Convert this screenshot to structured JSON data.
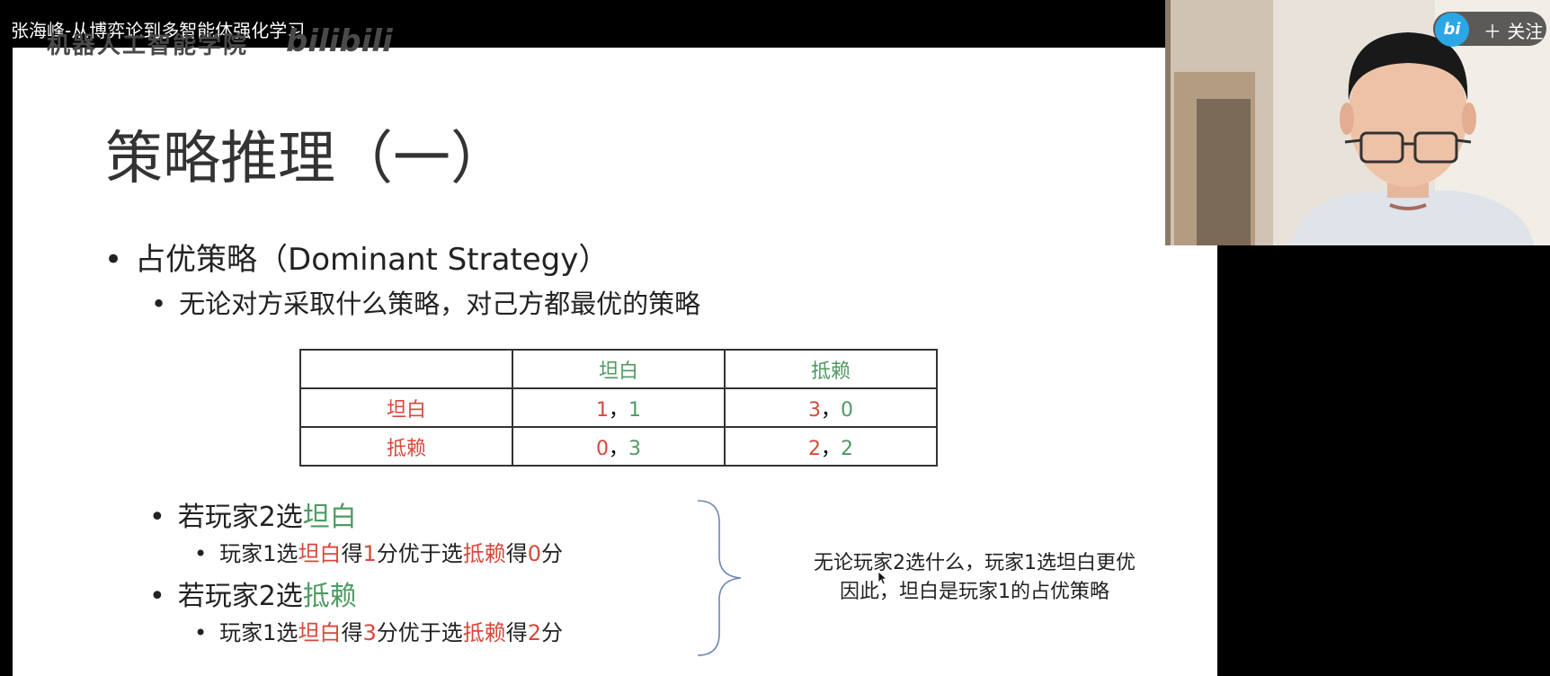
{
  "video": {
    "title": "张海峰-从博弈论到多智能体强化学习"
  },
  "watermark": {
    "text": "机器人工智能学院",
    "logo": "bilibili"
  },
  "player": {
    "follow_button": "＋ 关注",
    "logo_label": "bi"
  },
  "slide": {
    "title": "策略推理（一）",
    "bullet1": "占优策略（Dominant Strategy）",
    "bullet1_sub": "无论对方采取什么策略，对己方都最优的策略",
    "table": {
      "header": [
        "",
        "坦白",
        "抵赖"
      ],
      "rows": [
        {
          "label": "坦白",
          "cells": [
            {
              "a": "1",
              "b": "1"
            },
            {
              "a": "3",
              "b": "0"
            }
          ]
        },
        {
          "label": "抵赖",
          "cells": [
            {
              "a": "0",
              "b": "3"
            },
            {
              "a": "2",
              "b": "2"
            }
          ]
        }
      ],
      "separator": "，"
    },
    "case1": {
      "prefix": "若玩家2选",
      "choice": "坦白"
    },
    "case1_sub": {
      "p1": "玩家1选",
      "c1": "坦白",
      "p2": "得",
      "n1": "1",
      "p3": "分优于选",
      "c2": "抵赖",
      "p4": "得",
      "n2": "0",
      "p5": "分"
    },
    "case2": {
      "prefix": "若玩家2选",
      "choice": "抵赖"
    },
    "case2_sub": {
      "p1": "玩家1选",
      "c1": "坦白",
      "p2": "得",
      "n1": "3",
      "p3": "分优于选",
      "c2": "抵赖",
      "p4": "得",
      "n2": "2",
      "p5": "分"
    },
    "conclusion_line1": "无论玩家2选什么，玩家1选坦白更优",
    "conclusion_line2": "因此，坦白是玩家1的占优策略"
  },
  "colors": {
    "red": "#d9483b",
    "green": "#4f9a63",
    "brace": "#6f86b8",
    "bilibili": "#2ba6e6"
  },
  "icons": {
    "brace": "right-brace-icon",
    "cursor": "mouse-cursor-icon"
  }
}
